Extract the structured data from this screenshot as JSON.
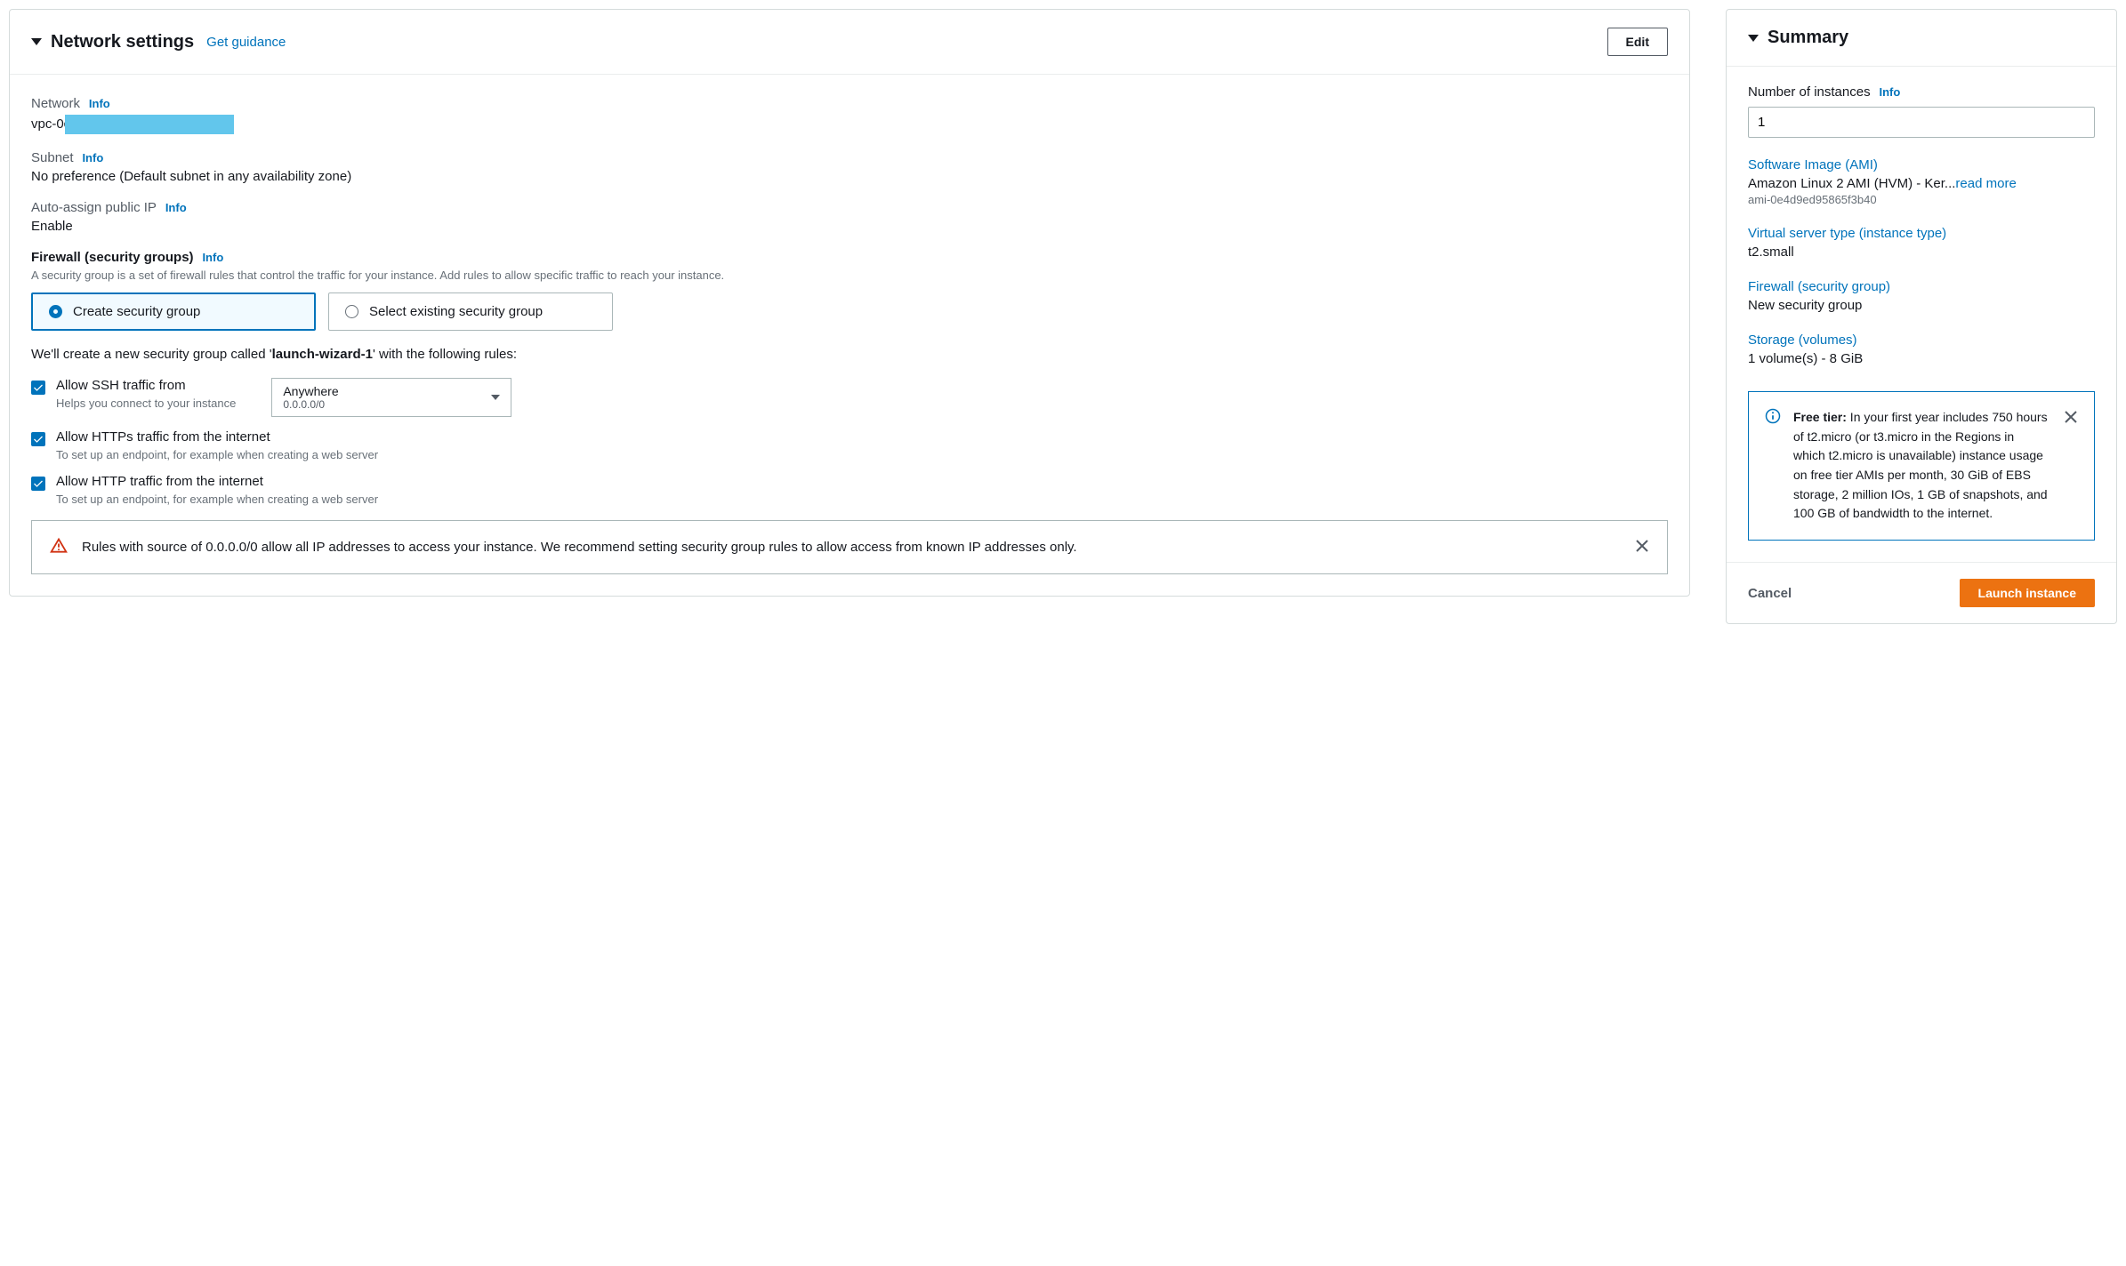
{
  "network": {
    "title": "Network settings",
    "guidance": "Get guidance",
    "edit": "Edit",
    "network_label": "Network",
    "info": "Info",
    "vpc_prefix": "vpc-0c",
    "subnet_label": "Subnet",
    "subnet_value": "No preference (Default subnet in any availability zone)",
    "autoip_label": "Auto-assign public IP",
    "autoip_value": "Enable",
    "firewall_label": "Firewall (security groups)",
    "firewall_hint": "A security group is a set of firewall rules that control the traffic for your instance. Add rules to allow specific traffic to reach your instance.",
    "create_sg": "Create security group",
    "select_sg": "Select existing security group",
    "sg_note_pre": "We'll create a new security group called '",
    "sg_name": "launch-wizard-1",
    "sg_note_post": "' with the following rules:",
    "ssh_label": "Allow SSH traffic from",
    "ssh_hint": "Helps you connect to your instance",
    "ssh_from": "Anywhere",
    "ssh_cidr": "0.0.0.0/0",
    "https_label": "Allow HTTPs traffic from the internet",
    "https_hint": "To set up an endpoint, for example when creating a web server",
    "http_label": "Allow HTTP traffic from the internet",
    "http_hint": "To set up an endpoint, for example when creating a web server",
    "warn": "Rules with source of 0.0.0.0/0 allow all IP addresses to access your instance. We recommend setting security group rules to allow access from known IP addresses only."
  },
  "summary": {
    "title": "Summary",
    "num_label": "Number of instances",
    "num_value": "1",
    "info": "Info",
    "ami_label": "Software Image (AMI)",
    "ami_value": "Amazon Linux 2 AMI (HVM) - Ker...",
    "read_more": "read more",
    "ami_id": "ami-0e4d9ed95865f3b40",
    "type_label": "Virtual server type (instance type)",
    "type_value": "t2.small",
    "fw_label": "Firewall (security group)",
    "fw_value": "New security group",
    "storage_label": "Storage (volumes)",
    "storage_value": "1 volume(s) - 8 GiB",
    "free_tier_bold": "Free tier:",
    "free_tier": " In your first year includes 750 hours of t2.micro (or t3.micro in the Regions in which t2.micro is unavailable) instance usage on free tier AMIs per month, 30 GiB of EBS storage, 2 million IOs, 1 GB of snapshots, and 100 GB of bandwidth to the internet.",
    "cancel": "Cancel",
    "launch": "Launch instance"
  }
}
